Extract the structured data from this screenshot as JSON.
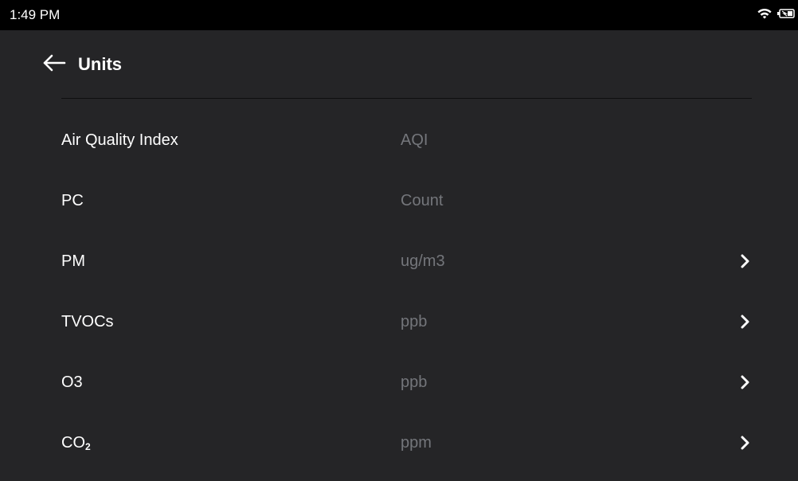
{
  "status_bar": {
    "time": "1:49 PM",
    "icons": [
      "wifi-icon",
      "battery-icon"
    ]
  },
  "header": {
    "title": "Units",
    "back_icon": "back-arrow-icon"
  },
  "units": [
    {
      "label": "Air Quality Index",
      "value": "AQI",
      "has_chevron": false
    },
    {
      "label": "PC",
      "value": "Count",
      "has_chevron": false
    },
    {
      "label": "PM",
      "value": "ug/m3",
      "has_chevron": true
    },
    {
      "label": "TVOCs",
      "value": "ppb",
      "has_chevron": true
    },
    {
      "label": "O3",
      "value": "ppb",
      "has_chevron": true
    },
    {
      "label": "CO",
      "label_subscript": "2",
      "value": "ppm",
      "has_chevron": true
    }
  ],
  "colors": {
    "background": "#252527",
    "status_bar": "#000000",
    "label_text": "#ffffff",
    "value_text": "#74767b",
    "divider": "#0e0e0f"
  }
}
